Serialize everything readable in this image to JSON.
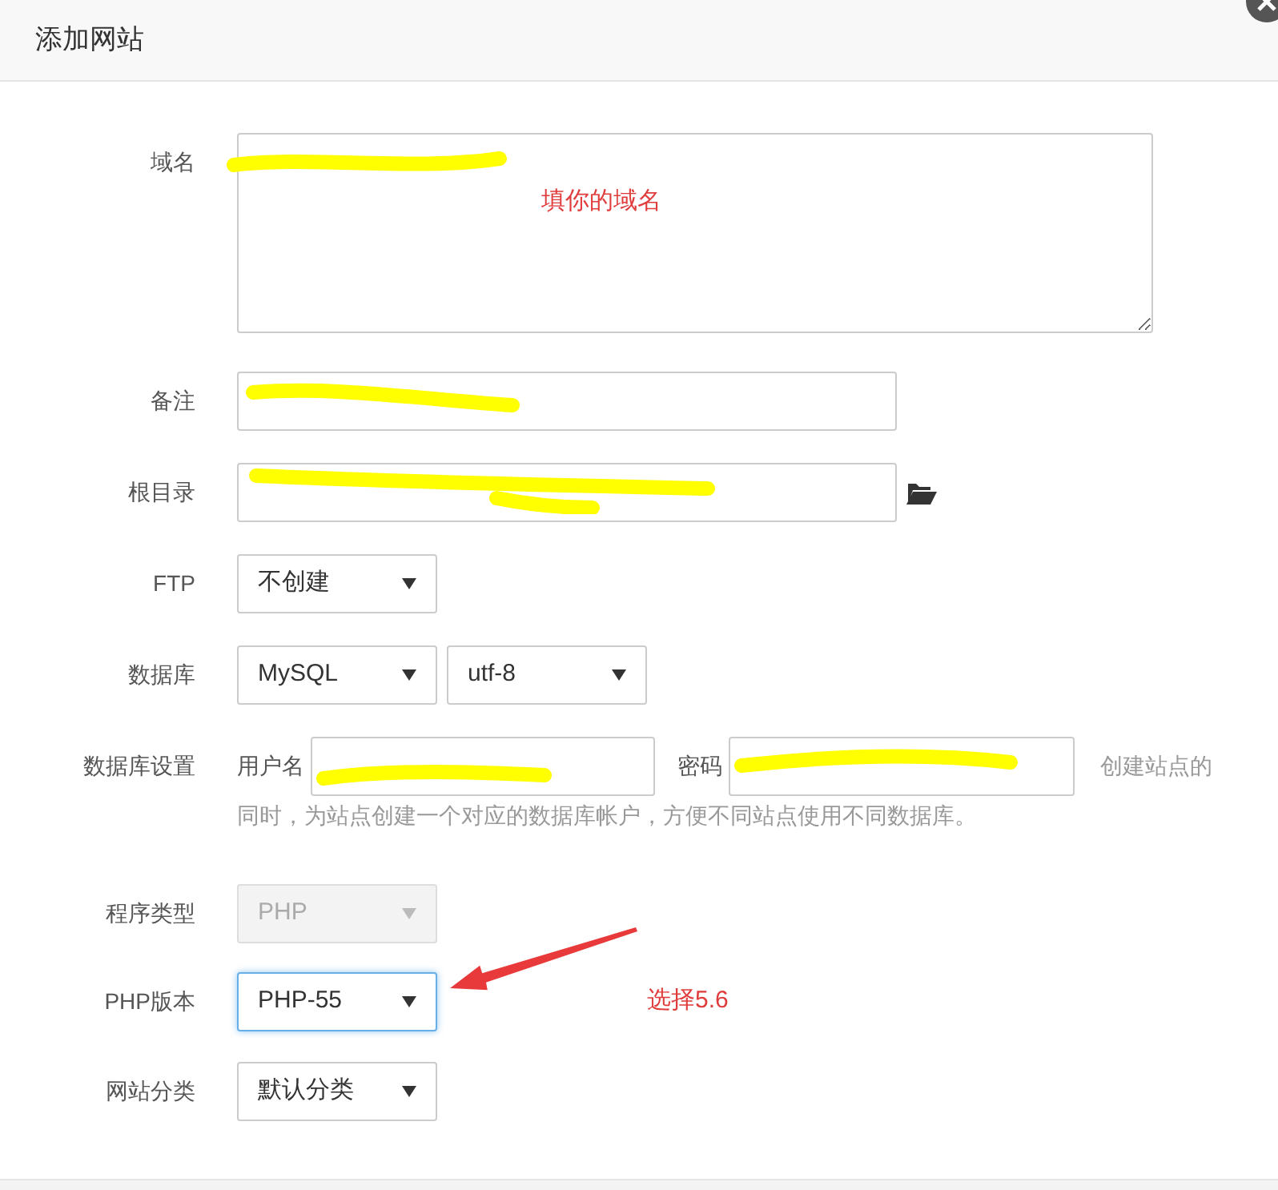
{
  "dialog": {
    "title": "添加网站"
  },
  "fields": [
    {
      "kind": "textarea",
      "label": "域名",
      "annotation": "填你的域名",
      "redacted": true
    },
    {
      "kind": "text",
      "label": "备注",
      "redacted": true
    },
    {
      "kind": "path",
      "label": "根目录",
      "redacted": true
    },
    {
      "kind": "select",
      "label": "FTP",
      "selects": [
        {
          "value": "不创建",
          "disabled": false,
          "focused": false
        }
      ]
    },
    {
      "kind": "select",
      "label": "数据库",
      "selects": [
        {
          "value": "MySQL",
          "disabled": false,
          "focused": false
        },
        {
          "value": "utf-8",
          "disabled": false,
          "focused": false
        }
      ]
    },
    {
      "kind": "credentials",
      "label": "数据库设置",
      "user_label": "用户名",
      "password_label": "密码",
      "redacted": true,
      "hint_lines": [
        "创建站点的",
        "同时，为站点创建一个对应的数据库帐户，方便不同站点使用不同数据库。"
      ]
    },
    {
      "kind": "select",
      "label": "程序类型",
      "selects": [
        {
          "value": "PHP",
          "disabled": true,
          "focused": false
        }
      ]
    },
    {
      "kind": "select",
      "label": "PHP版本",
      "selects": [
        {
          "value": "PHP-55",
          "disabled": false,
          "focused": true
        }
      ],
      "annotation": "选择5.6"
    },
    {
      "kind": "select",
      "label": "网站分类",
      "selects": [
        {
          "value": "默认分类",
          "disabled": false,
          "focused": false
        }
      ]
    }
  ]
}
